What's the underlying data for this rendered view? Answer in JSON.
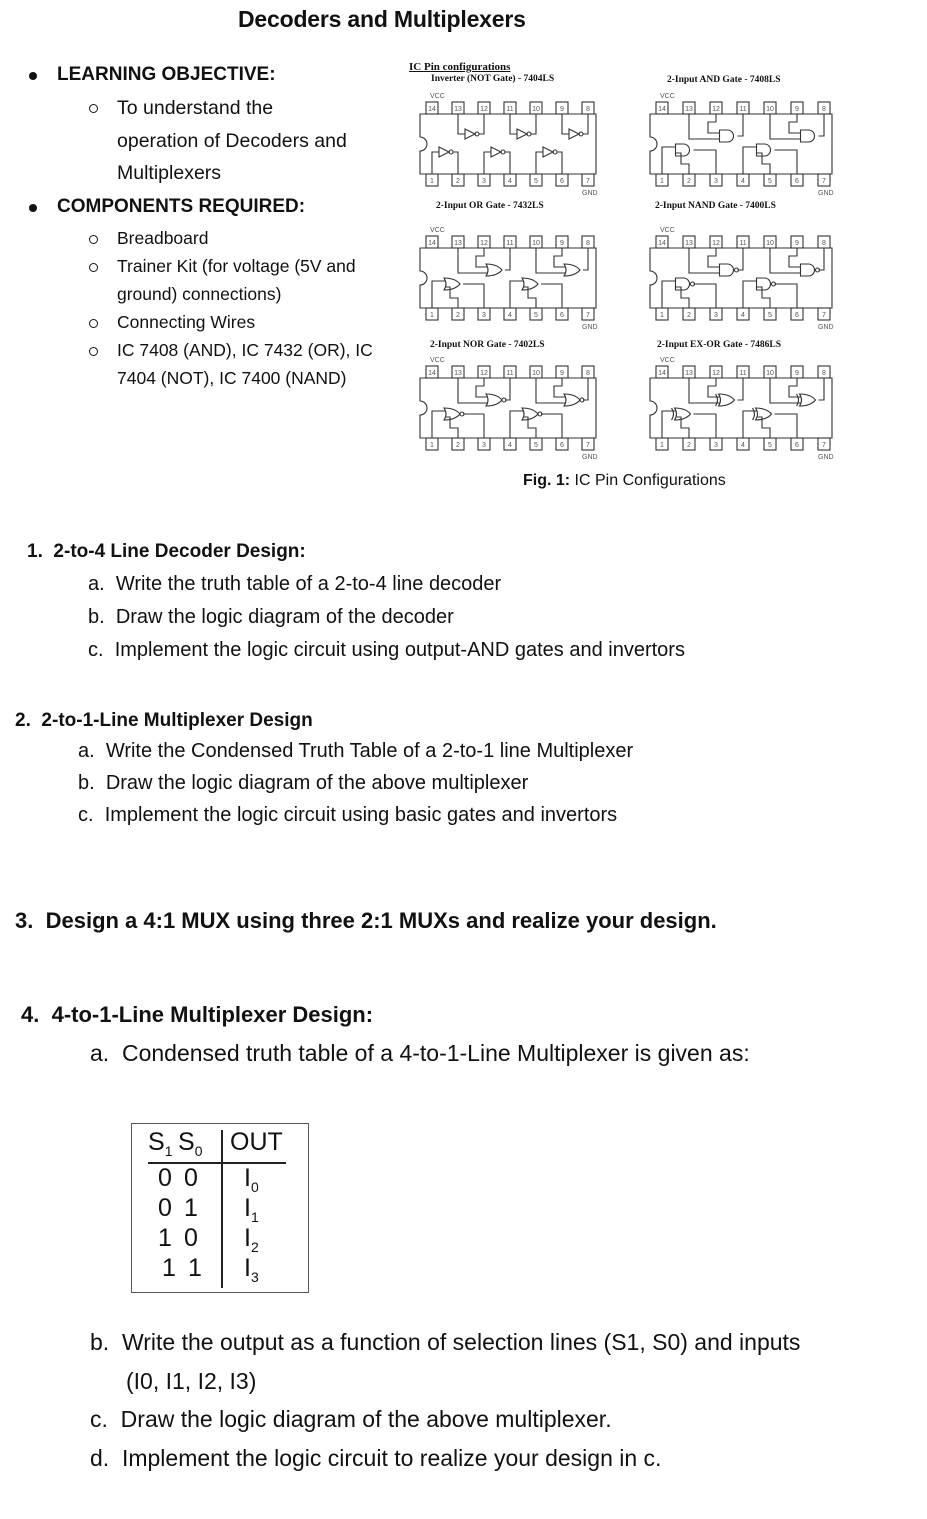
{
  "page": {
    "title": "Decoders and Multiplexers"
  },
  "learning_objective": {
    "heading": "LEARNING OBJECTIVE:",
    "items": [
      {
        "lines": [
          "To understand the",
          "operation of Decoders and",
          "Multiplexers"
        ]
      }
    ]
  },
  "components": {
    "heading": "COMPONENTS REQUIRED:",
    "items": [
      {
        "lines": [
          "Breadboard"
        ]
      },
      {
        "lines": [
          "Trainer Kit (for voltage (5V and",
          "ground) connections)"
        ]
      },
      {
        "lines": [
          "Connecting Wires"
        ]
      },
      {
        "lines": [
          "IC 7408 (AND), IC 7432 (OR), IC",
          "7404 (NOT), IC 7400 (NAND)"
        ]
      }
    ]
  },
  "figure": {
    "heading": "IC Pin configurations",
    "caption_bold": "Fig. 1:",
    "caption_text": " IC Pin Configurations",
    "vcc_label": "VCC",
    "gnd_label": "GND",
    "top_pins": [
      "14",
      "13",
      "12",
      "11",
      "10",
      "9",
      "8"
    ],
    "bottom_pins": [
      "1",
      "2",
      "3",
      "4",
      "5",
      "6",
      "7"
    ],
    "ics": [
      {
        "label": "Inverter (NOT Gate) - 7404LS",
        "gate": "not"
      },
      {
        "label": "2-Input AND Gate - 7408LS",
        "gate": "and"
      },
      {
        "label": "2-Input OR Gate - 7432LS",
        "gate": "or"
      },
      {
        "label": "2-Input NAND Gate - 7400LS",
        "gate": "nand"
      },
      {
        "label": "2-Input NOR Gate - 7402LS",
        "gate": "nor"
      },
      {
        "label": "2-Input EX-OR Gate - 7486LS",
        "gate": "xor"
      }
    ]
  },
  "sections": [
    {
      "number": "1.",
      "title": "2-to-4 Line Decoder Design:",
      "items": [
        {
          "marker": "a.",
          "text": "Write the truth table of a 2-to-4 line decoder"
        },
        {
          "marker": "b.",
          "text": "Draw the logic diagram of the decoder"
        },
        {
          "marker": "c.",
          "text": "Implement the logic circuit using output-AND gates and invertors"
        }
      ]
    },
    {
      "number": "2.",
      "title": "2-to-1-Line Multiplexer Design",
      "items": [
        {
          "marker": "a.",
          "text": "Write the Condensed Truth Table of a 2-to-1 line Multiplexer"
        },
        {
          "marker": "b.",
          "text": "Draw the logic diagram of the above multiplexer"
        },
        {
          "marker": "c.",
          "text": "Implement the logic circuit using basic gates and invertors"
        }
      ]
    },
    {
      "number": "3.",
      "title": "Design a 4:1 MUX using three 2:1 MUXs and realize your design.",
      "items": []
    },
    {
      "number": "4.",
      "title": "4-to-1-Line Multiplexer Design:",
      "items": [
        {
          "marker": "a.",
          "text": "Condensed truth table of a 4-to-1-Line Multiplexer is given as:"
        },
        {
          "marker": "b.",
          "text": "Write the output as a function of selection lines (S1, S0) and inputs"
        },
        {
          "marker": "",
          "text": "(I0, I1, I2, I3)"
        },
        {
          "marker": "c.",
          "text": "Draw the logic diagram of the above multiplexer."
        },
        {
          "marker": "d.",
          "text": "Implement the logic circuit to realize your design in c."
        }
      ]
    }
  ],
  "mux_table": {
    "headers": {
      "s1": "S",
      "s1_sub": "1",
      "s0": "S",
      "s0_sub": "0",
      "out": "OUT"
    },
    "rows": [
      {
        "s1": "0",
        "s0": "0",
        "out": "I",
        "out_sub": "0"
      },
      {
        "s1": "0",
        "s0": "1",
        "out": "I",
        "out_sub": "1"
      },
      {
        "s1": "1",
        "s0": "0",
        "out": "I",
        "out_sub": "2"
      },
      {
        "s1": "1",
        "s0": "1",
        "out": "I",
        "out_sub": "3"
      }
    ]
  }
}
